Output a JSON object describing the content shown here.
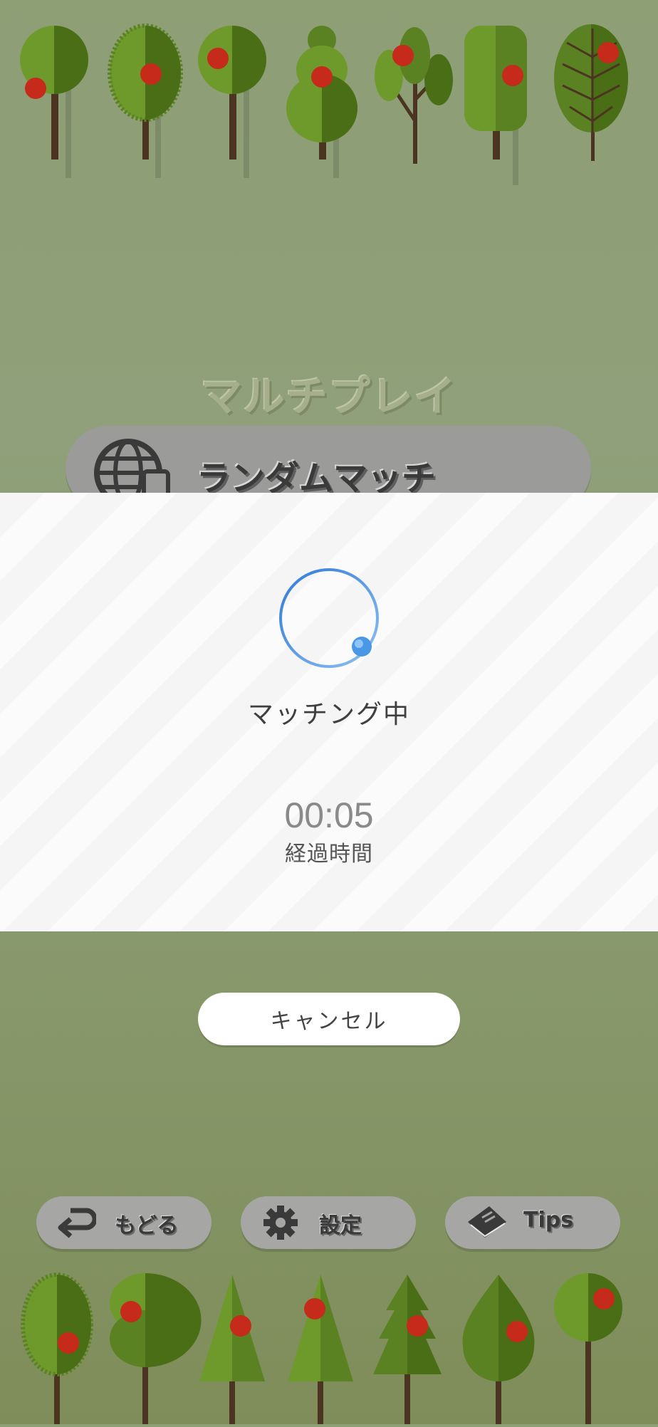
{
  "screen_title": "マルチプレイ",
  "menu": {
    "random_match_label": "ランダムマッチ"
  },
  "matching": {
    "status": "マッチング中",
    "elapsed_time": "00:05",
    "elapsed_label": "経過時間"
  },
  "cancel_label": "キャンセル",
  "bottom_nav": {
    "back_label": "もどる",
    "settings_label": "設定",
    "tips_label": "Tips"
  },
  "colors": {
    "background": "#8e9e75",
    "leaf_light": "#6e9a2c",
    "leaf_dark": "#4a6e16",
    "apple": "#c62a1a",
    "spinner": "#3d86e0",
    "modal": "#fbfbfb"
  }
}
